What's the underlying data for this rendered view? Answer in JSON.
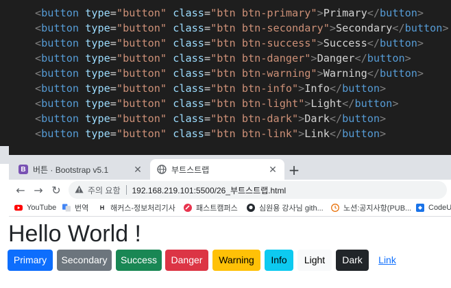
{
  "editor": {
    "lines": [
      {
        "cls": "btn btn-primary",
        "text": "Primary"
      },
      {
        "cls": "btn btn-secondary",
        "text": "Secondary"
      },
      {
        "cls": "btn btn-success",
        "text": "Success"
      },
      {
        "cls": "btn btn-danger",
        "text": "Danger"
      },
      {
        "cls": "btn btn-warning",
        "text": "Warning"
      },
      {
        "cls": "btn btn-info",
        "text": "Info"
      },
      {
        "cls": "btn btn-light",
        "text": "Light"
      },
      {
        "cls": "btn btn-dark",
        "text": "Dark"
      },
      {
        "cls": "btn btn-link",
        "text": "Link"
      }
    ],
    "tag": "button",
    "attr_type": "type",
    "type_value": "button",
    "attr_class": "class",
    "colors": {
      "background": "#1e1e1e",
      "tag": "#569cd6",
      "attribute": "#9cdcfe",
      "string": "#ce9178",
      "text": "#d4d4d4",
      "bracket": "#808080"
    }
  },
  "browser": {
    "tabs": [
      {
        "title": "버튼 · Bootstrap v5.1",
        "favicon": "bootstrap-logo",
        "favicon_text": "B",
        "active": false
      },
      {
        "title": "부트스트랩",
        "favicon": "globe-icon",
        "active": true
      }
    ],
    "tab_close_glyph": "✕",
    "new_tab_glyph": "+",
    "nav": {
      "back": "←",
      "forward": "→",
      "reload": "↻"
    },
    "security_label": "주의 요함",
    "url": "192.168.219.101:5500/26_부트스트랩.html",
    "bookmarks": [
      {
        "label": "YouTube",
        "icon": "youtube-icon"
      },
      {
        "label": "번역",
        "icon": "translate-icon"
      },
      {
        "label": "해커스-정보처리기사",
        "icon": "hackers-icon"
      },
      {
        "label": "패스트캠퍼스",
        "icon": "fastcampus-icon"
      },
      {
        "label": "심원용 강사님 gith...",
        "icon": "github-icon"
      },
      {
        "label": "노션:공지사항(PUB...",
        "icon": "notion-icon"
      },
      {
        "label": "CodeU",
        "icon": "codeup-icon"
      }
    ]
  },
  "page": {
    "heading": "Hello World !",
    "buttons": [
      {
        "label": "Primary",
        "variant": "primary",
        "color": "#0d6efd"
      },
      {
        "label": "Secondary",
        "variant": "secondary",
        "color": "#6c757d"
      },
      {
        "label": "Success",
        "variant": "success",
        "color": "#198754"
      },
      {
        "label": "Danger",
        "variant": "danger",
        "color": "#dc3545"
      },
      {
        "label": "Warning",
        "variant": "warning",
        "color": "#ffc107"
      },
      {
        "label": "Info",
        "variant": "info",
        "color": "#0dcaf0"
      },
      {
        "label": "Light",
        "variant": "light",
        "color": "#f8f9fa"
      },
      {
        "label": "Dark",
        "variant": "dark",
        "color": "#212529"
      },
      {
        "label": "Link",
        "variant": "link",
        "color": "#0d6efd"
      }
    ]
  }
}
